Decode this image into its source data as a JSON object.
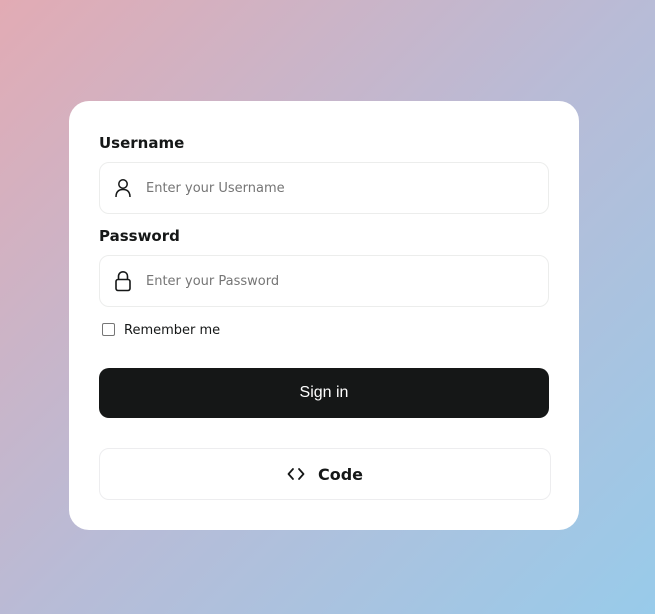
{
  "form": {
    "username_label": "Username",
    "username_placeholder": "Enter your Username",
    "password_label": "Password",
    "password_placeholder": "Enter your Password",
    "remember_label": "Remember me",
    "remember_checked": false,
    "signin_label": "Sign in",
    "code_label": "Code"
  },
  "icons": {
    "username": "user-icon",
    "password": "lock-icon",
    "code": "code-brackets-icon"
  },
  "colors": {
    "button_bg": "#151717",
    "card_bg": "#ffffff",
    "gradient_start": "#e2abb4",
    "gradient_end": "#98cbea"
  }
}
